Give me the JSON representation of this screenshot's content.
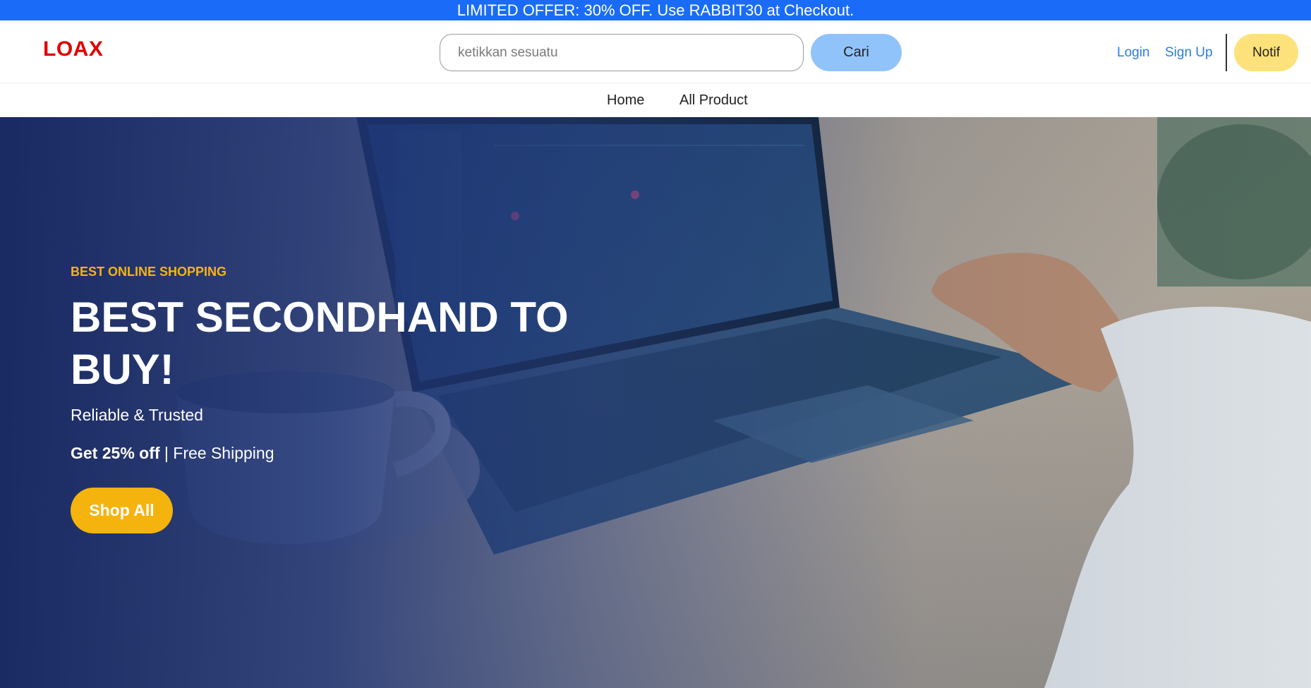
{
  "promo": {
    "text": "LIMITED OFFER: 30% OFF. Use RABBIT30 at Checkout."
  },
  "header": {
    "logo": "LOAX",
    "search_placeholder": "ketikkan sesuatu",
    "search_value": "",
    "search_button": "Cari",
    "login": "Login",
    "signup": "Sign Up",
    "notif": "Notif"
  },
  "nav": {
    "items": [
      {
        "label": "Home"
      },
      {
        "label": "All Product"
      }
    ]
  },
  "hero": {
    "eyebrow": "BEST ONLINE SHOPPING",
    "title": "BEST SECONDHAND TO BUY!",
    "subtitle": "Reliable & Trusted",
    "offer_bold": "Get 25% off",
    "offer_rest": " | Free Shipping",
    "cta": "Shop All",
    "image_subject": "laptop-with-coffee-cup-photo"
  },
  "colors": {
    "promo_bg": "#1a6cf8",
    "logo": "#e00000",
    "search_button_bg": "#91c3fb",
    "link": "#2a7de1",
    "notif_bg": "#fde27b",
    "accent": "#f5b30e",
    "hero_overlay": "#142560"
  }
}
